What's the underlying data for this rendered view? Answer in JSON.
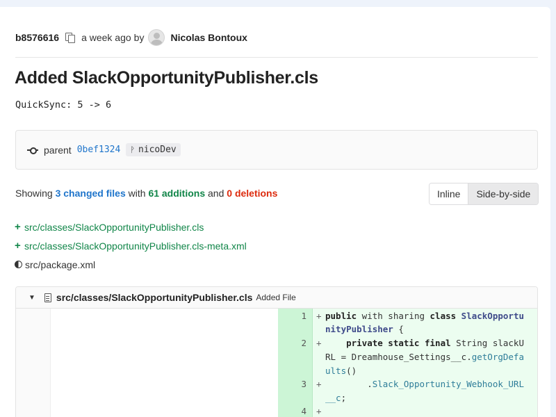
{
  "commit": {
    "sha": "b8576616",
    "time": "a week ago",
    "by_label": "by",
    "author": "Nicolas Bontoux",
    "title": "Added SlackOpportunityPublisher.cls",
    "description": "QuickSync: 5 -> 6"
  },
  "parent": {
    "label": "parent",
    "sha": "0bef1324",
    "branch": "nicoDev"
  },
  "summary": {
    "prefix": "Showing",
    "files": "3 changed files",
    "with": "with",
    "additions": "61 additions",
    "and": "and",
    "deletions": "0 deletions"
  },
  "view_toggle": {
    "inline_label": "Inline",
    "side_by_side_label": "Side-by-side",
    "selected": "Side-by-side"
  },
  "files": [
    {
      "path": "src/classes/SlackOpportunityPublisher.cls",
      "status": "added"
    },
    {
      "path": "src/classes/SlackOpportunityPublisher.cls-meta.xml",
      "status": "added"
    },
    {
      "path": "src/package.xml",
      "status": "modified"
    }
  ],
  "diff": {
    "path": "src/classes/SlackOpportunityPublisher.cls",
    "status_label": "Added File",
    "lines": [
      {
        "num": "1",
        "sign": "+"
      },
      {
        "num": "2",
        "sign": "+"
      },
      {
        "num": "3",
        "sign": "+"
      },
      {
        "num": "4",
        "sign": "+"
      }
    ],
    "code": {
      "l1a_kw1": "public",
      "l1a_t1": " with sharing ",
      "l1a_kw2": "class",
      "l1a_cls": " SlackOpportu",
      "l1b_cls": "nityPublisher",
      "l1b_t": " {",
      "l2a_kw": "    private static final",
      "l2a_t": " String slackU",
      "l2b_t": "RL = Dreamhouse_Settings__c.",
      "l2b_fn": "getOrgDefa",
      "l2c_fn": "ults",
      "l2c_t": "()",
      "l3a_t": "        .",
      "l3a_fn": "Slack_Opportunity_Webhook_URL",
      "l3b_fn": "__c",
      "l3b_t": ";"
    }
  }
}
